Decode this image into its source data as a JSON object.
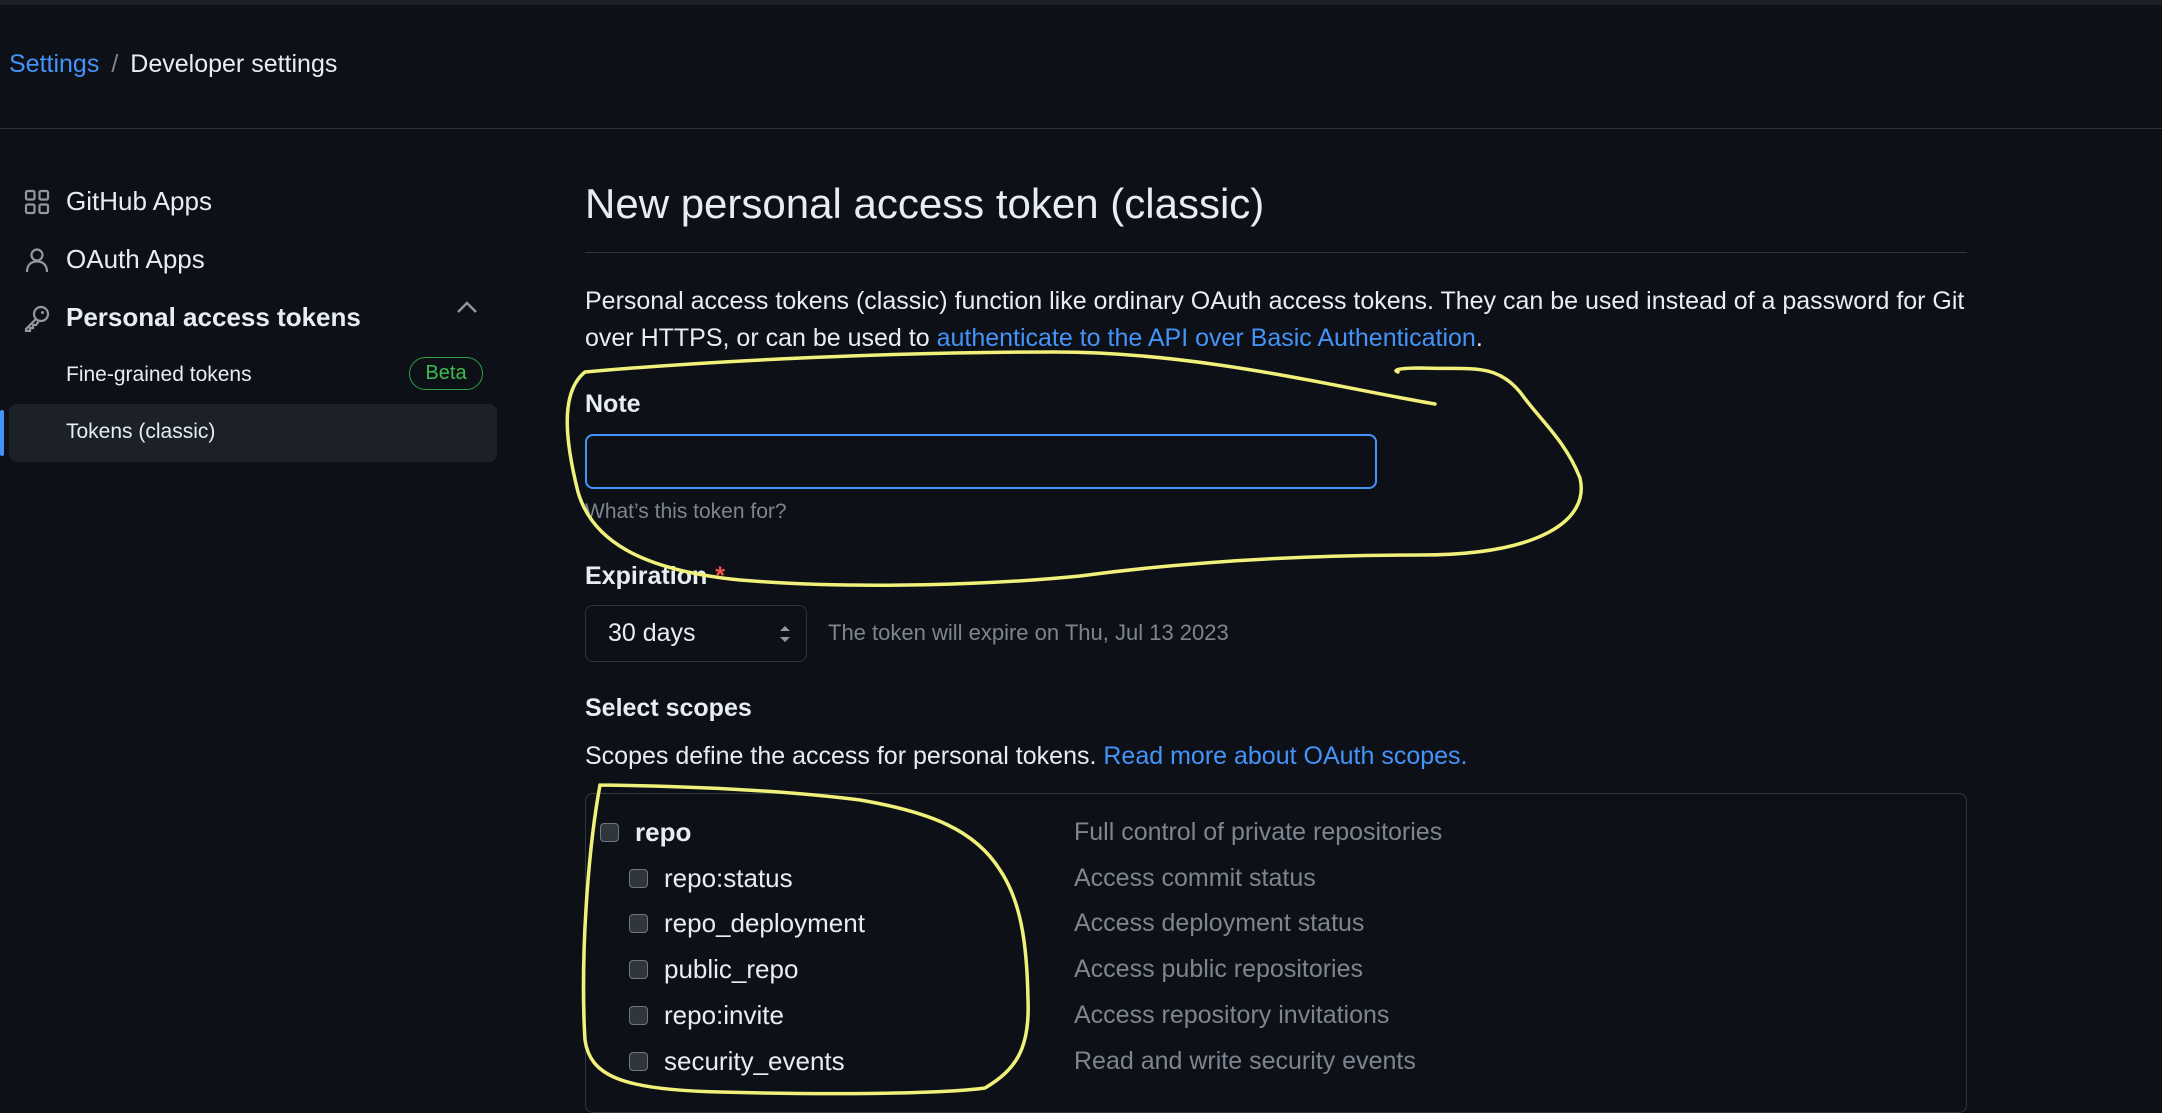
{
  "breadcrumb": {
    "settings": "Settings",
    "separator": "/",
    "current": "Developer settings"
  },
  "sidebar": {
    "items": [
      {
        "label": "GitHub Apps",
        "icon": "apps-grid-icon"
      },
      {
        "label": "OAuth Apps",
        "icon": "person-icon"
      },
      {
        "label": "Personal access tokens",
        "icon": "key-icon"
      }
    ],
    "sub_items": [
      {
        "label": "Fine-grained tokens",
        "badge": "Beta"
      },
      {
        "label": "Tokens (classic)",
        "selected": true
      }
    ]
  },
  "main": {
    "title": "New personal access token (classic)",
    "description_pre": "Personal access tokens (classic) function like ordinary OAuth access tokens. They can be used instead of a password for Git over HTTPS, or can be used to ",
    "description_link": "authenticate to the API over Basic Authentication",
    "description_post": ".",
    "note": {
      "label": "Note",
      "value": "",
      "hint": "What’s this token for?"
    },
    "expiration": {
      "label": "Expiration",
      "required_mark": "*",
      "selected": "30 days",
      "info": "The token will expire on Thu, Jul 13 2023"
    },
    "scopes": {
      "heading": "Select scopes",
      "desc": "Scopes define the access for personal tokens.",
      "link": "Read more about OAuth scopes.",
      "rows": [
        {
          "name": "repo",
          "desc": "Full control of private repositories"
        },
        {
          "name": "repo:status",
          "desc": "Access commit status"
        },
        {
          "name": "repo_deployment",
          "desc": "Access deployment status"
        },
        {
          "name": "public_repo",
          "desc": "Access public repositories"
        },
        {
          "name": "repo:invite",
          "desc": "Access repository invitations"
        },
        {
          "name": "security_events",
          "desc": "Read and write security events"
        }
      ]
    }
  },
  "colors": {
    "accent": "#4493f8",
    "background": "#0d1117",
    "annotation": "#f0f07a",
    "badge": "#3fb950"
  }
}
